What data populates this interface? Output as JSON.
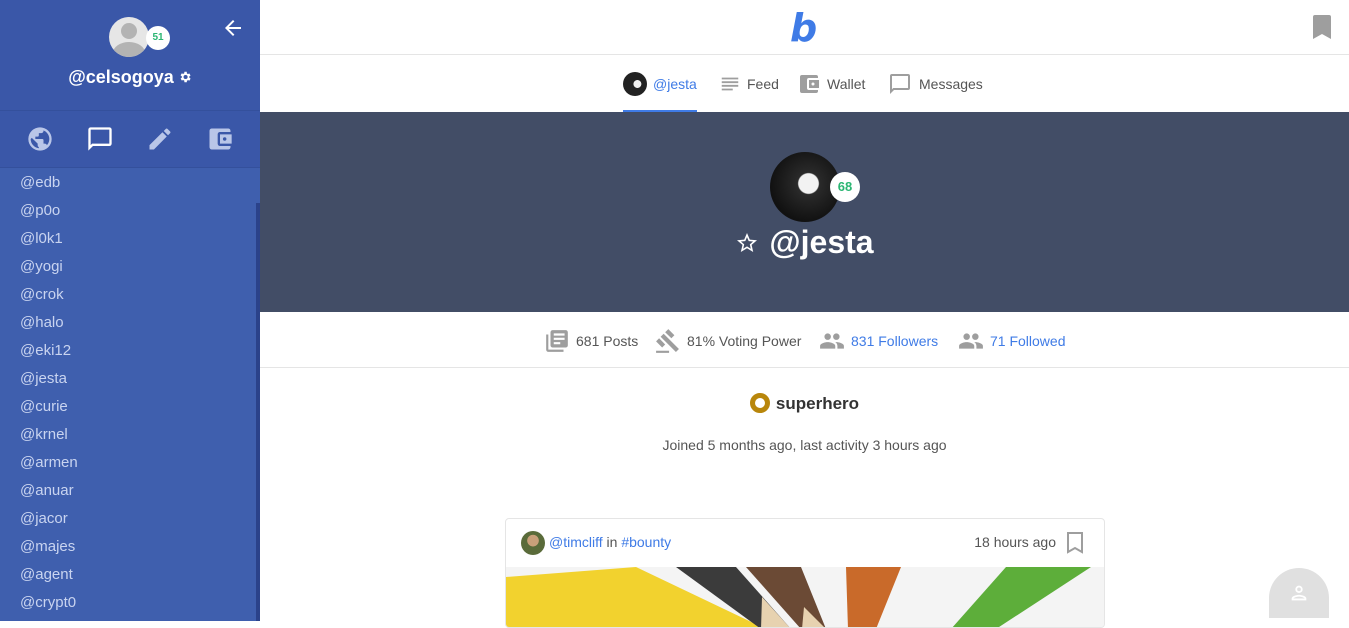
{
  "sidebar": {
    "username": "@celsogoya",
    "reputation": "51",
    "accounts": [
      "@edb",
      "@p0o",
      "@l0k1",
      "@yogi",
      "@crok",
      "@halo",
      "@eki12",
      "@jesta",
      "@curie",
      "@krnel",
      "@armen",
      "@anuar",
      "@jacor",
      "@majes",
      "@agent",
      "@crypt0"
    ]
  },
  "topbar": {
    "logo": "b"
  },
  "tabs": [
    {
      "label": "@jesta",
      "active": true
    },
    {
      "label": "Feed"
    },
    {
      "label": "Wallet"
    },
    {
      "label": "Messages"
    }
  ],
  "profile": {
    "name": "@jesta",
    "reputation": "68"
  },
  "stats": {
    "posts": "681 Posts",
    "voting_power": "81% Voting Power",
    "followers": "831 Followers",
    "followed": "71 Followed"
  },
  "badge": "superhero",
  "joined": "Joined 5 months ago, last activity 3 hours ago",
  "post": {
    "author": "@timcliff",
    "in_word": "in",
    "tag": "#bounty",
    "time": "18 hours ago"
  },
  "colors": {
    "accent": "#3f7be6",
    "sidebar": "#3f5fae",
    "banner": "#424d66",
    "rep": "#2bb673"
  }
}
